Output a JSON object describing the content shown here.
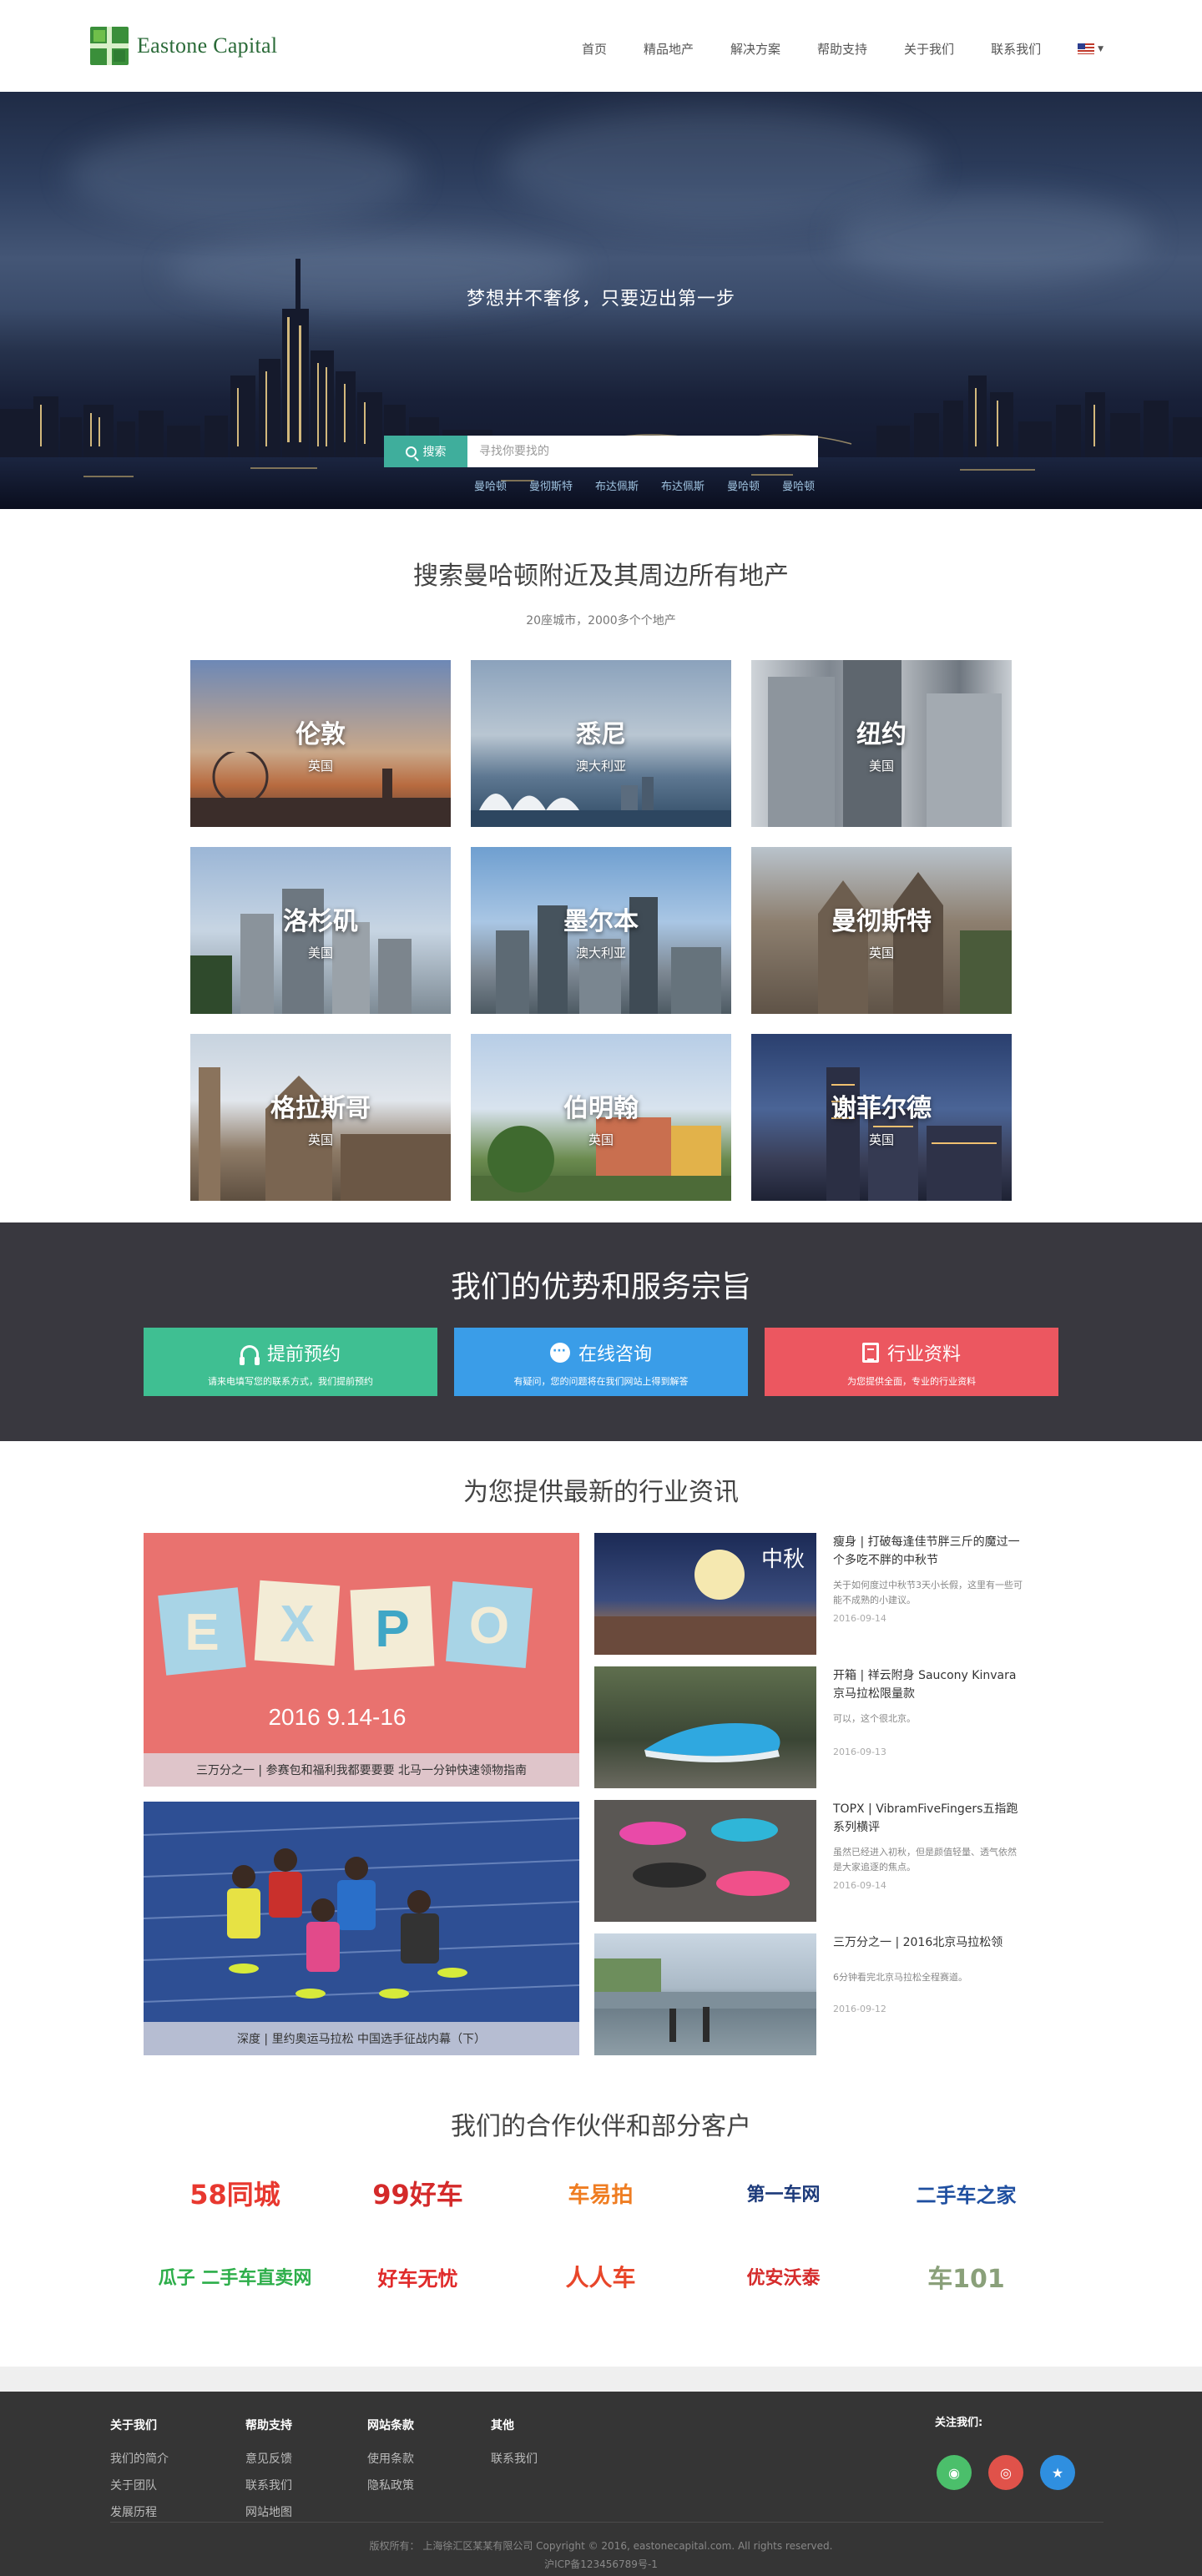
{
  "brand": {
    "name": "Eastone Capital"
  },
  "nav": {
    "items": [
      "首页",
      "精品地产",
      "解决方案",
      "帮助支持",
      "关于我们",
      "联系我们"
    ]
  },
  "hero": {
    "title": "梦想并不奢侈，只要迈出第一步",
    "search_button": "搜索",
    "search_placeholder": "寻找你要找的",
    "hot_tags": [
      "曼哈顿",
      "曼彻斯特",
      "布达佩斯",
      "布达佩斯",
      "曼哈顿",
      "曼哈顿"
    ]
  },
  "cities": {
    "title": "搜索曼哈顿附近及其周边所有地产",
    "subtitle": "20座城市，2000多个个地产",
    "items": [
      {
        "name": "伦敦",
        "country": "英国"
      },
      {
        "name": "悉尼",
        "country": "澳大利亚"
      },
      {
        "name": "纽约",
        "country": "美国"
      },
      {
        "name": "洛杉矶",
        "country": "美国"
      },
      {
        "name": "墨尔本",
        "country": "澳大利亚"
      },
      {
        "name": "曼彻斯特",
        "country": "英国"
      },
      {
        "name": "格拉斯哥",
        "country": "英国"
      },
      {
        "name": "伯明翰",
        "country": "英国"
      },
      {
        "name": "谢菲尔德",
        "country": "英国"
      }
    ]
  },
  "advantages": {
    "title": "我们的优势和服务宗旨",
    "cards": [
      {
        "title": "提前预约",
        "desc": "请来电填写您的联系方式，我们提前预约",
        "color": "#3fbf92",
        "icon": "headset-icon"
      },
      {
        "title": "在线咨询",
        "desc": "有疑问，您的问题将在我们网站上得到解答",
        "color": "#3a9de8",
        "icon": "chat-icon"
      },
      {
        "title": "行业资料",
        "desc": "为您提供全面，专业的行业资料",
        "color": "#ec5760",
        "icon": "book-icon"
      }
    ]
  },
  "news": {
    "title": "为您提供最新的行业资讯",
    "featured": [
      {
        "caption": "三万分之一 | 参赛包和福利我都要要要 北马一分钟快速领物指南",
        "banner_date": "2016 9.14-16",
        "banner_letters": [
          "E",
          "X",
          "P",
          "O"
        ]
      },
      {
        "caption": "深度 | 里约奥运马拉松 中国选手征战内幕（下）"
      }
    ],
    "items": [
      {
        "title": "瘦身 | 打破每逢佳节胖三斤的魔过一个多吃不胖的中秋节",
        "summary": "关于如何度过中秋节3天小长假，这里有一些可能不成熟的小建议。",
        "date": "2016-09-14",
        "thumb_text": "中秋"
      },
      {
        "title": "开箱 | 祥云附身 Saucony Kinvara京马拉松限量款",
        "summary": "可以，这个很北京。",
        "date": "2016-09-13"
      },
      {
        "title": "TOPX | VibramFiveFingers五指跑系列横评",
        "summary": "虽然已经进入初秋，但是颜值轻量、透气依然是大家追逐的焦点。",
        "date": "2016-09-14"
      },
      {
        "title": "三万分之一 | 2016北京马拉松领",
        "summary": "6分钟看完北京马拉松全程赛道。",
        "date": "2016-09-12"
      }
    ]
  },
  "partners": {
    "title": "我们的合作伙伴和部分客户",
    "logos": [
      {
        "text": "58同城",
        "color": "#e8382f"
      },
      {
        "text": "99好车",
        "color": "#d42a2a"
      },
      {
        "text": "车易拍",
        "color": "#ef7d22"
      },
      {
        "text": "第一车网",
        "color": "#1c3a7a"
      },
      {
        "text": "二手车之家",
        "color": "#1f4fa0"
      },
      {
        "text": "瓜子 二手车直卖网",
        "color": "#2dae4a"
      },
      {
        "text": "好车无忧",
        "color": "#e02a2a"
      },
      {
        "text": "人人车",
        "color": "#e8462a"
      },
      {
        "text": "优安沃泰",
        "color": "#d52b2b"
      },
      {
        "text": "车101",
        "color": "#8aa07a"
      }
    ]
  },
  "footer": {
    "cols": [
      {
        "heading": "关于我们",
        "links": [
          "我们的简介",
          "关于团队",
          "发展历程"
        ]
      },
      {
        "heading": "帮助支持",
        "links": [
          "意见反馈",
          "联系我们",
          "网站地图"
        ]
      },
      {
        "heading": "网站条款",
        "links": [
          "使用条款",
          "隐私政策"
        ]
      },
      {
        "heading": "其他",
        "links": [
          "联系我们"
        ]
      }
    ],
    "follow": "关注我们:",
    "socials": [
      {
        "name": "wechat-icon",
        "color": "#4bbf6b",
        "glyph": "◉"
      },
      {
        "name": "weibo-icon",
        "color": "#e0524a",
        "glyph": "◎"
      },
      {
        "name": "star-icon",
        "color": "#2f8fe0",
        "glyph": "★"
      }
    ],
    "copyright": "版权所有： 上海徐汇区某某有限公司 Copyright © 2016, eastonecapital.com. All rights reserved.",
    "icp": "沪ICP备123456789号-1"
  }
}
